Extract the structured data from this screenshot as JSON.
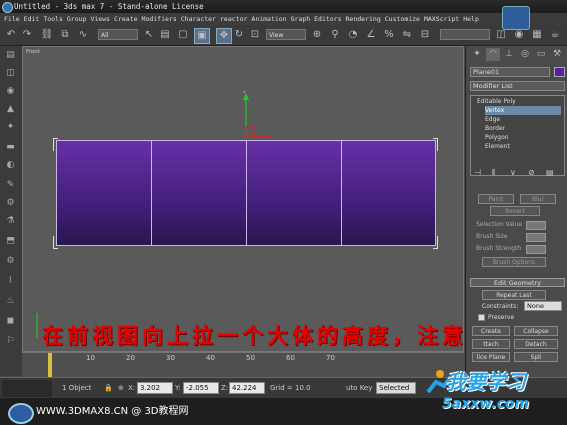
{
  "window": {
    "title": "Untitled  - 3ds max 7  - Stand-alone License"
  },
  "menu": [
    "File",
    "Edit",
    "Tools",
    "Group",
    "Views",
    "Create",
    "Modifiers",
    "Character",
    "reactor",
    "Animation",
    "Graph Editors",
    "Rendering",
    "Customize",
    "MAXScript",
    "Help"
  ],
  "toolbar": {
    "selection_filter": "All",
    "coord_system": "View"
  },
  "viewport": {
    "label": "Front",
    "axis_y": "y",
    "axis_x": "x",
    "overlay_text": "在前视图向上拉一个大体的高度，注意观测"
  },
  "time_ruler": {
    "ticks": [
      "10",
      "20",
      "30",
      "40",
      "50",
      "60",
      "70"
    ]
  },
  "status": {
    "selected": "1 Object",
    "x_label": "X:",
    "x_value": "3.202",
    "y_label": "Y:",
    "y_value": "-2.055",
    "z_label": "Z:",
    "z_value": "42.224",
    "grid": "Grid = 10.0",
    "auto_key": "uto Key",
    "selected_dropdown": "Selected"
  },
  "command_panel": {
    "object_name": "Plane01",
    "object_color": "#5a1f9a",
    "modifier_list": "Modifier List",
    "stack": [
      "Editable Poly",
      "Vertex",
      "Edge",
      "Border",
      "Polygon",
      "Element"
    ],
    "selected_stack_item": "Vertex",
    "soft_buttons": [
      "Paint",
      "Blur",
      "Revert"
    ],
    "soft_labels": [
      "Selection Value",
      "Brush Size",
      "Brush Strength",
      "Brush Options"
    ],
    "edit_geometry": {
      "title": "Edit Geometry",
      "repeat_last": "Repeat Last",
      "constraints_label": "Constraints:",
      "constraints_value": "None",
      "preserve": "Preserve",
      "create": "Create",
      "collapse": "Collapse",
      "attach": "ttach",
      "detach": "Detach",
      "slice_plane": "lice Plane",
      "split": "Spli"
    }
  },
  "footer": {
    "text": "WWW.3DMAX8.CN @ 3D教程网"
  },
  "logo": {
    "line1": "我要学习",
    "line2": "5axxw.com"
  },
  "colors": {
    "plane_top": "#6630a8",
    "plane_bottom": "#2a1650",
    "overlay": "#e80000",
    "logo": "#26a4e6"
  }
}
